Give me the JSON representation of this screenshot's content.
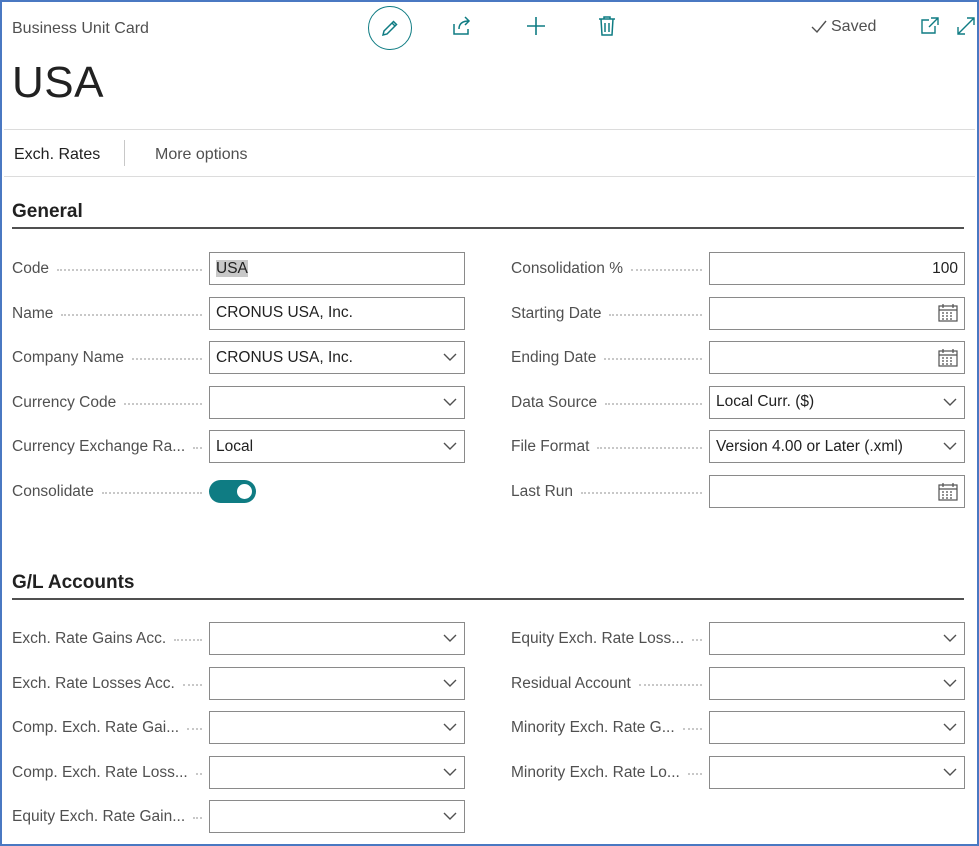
{
  "header": {
    "caption": "Business Unit Card",
    "title": "USA",
    "status": "Saved",
    "icons": [
      "edit-icon",
      "share-icon",
      "add-icon",
      "delete-icon",
      "checkmark-icon",
      "open-in-new-window-icon",
      "expand-icon"
    ]
  },
  "actions": {
    "exch_rates": "Exch. Rates",
    "more_options": "More options"
  },
  "general": {
    "title": "General",
    "left": [
      {
        "label": "Code",
        "value": "USA",
        "control": "text-selected"
      },
      {
        "label": "Name",
        "value": "CRONUS USA, Inc.",
        "control": "text"
      },
      {
        "label": "Company Name",
        "value": "CRONUS USA, Inc.",
        "control": "dropdown"
      },
      {
        "label": "Currency Code",
        "value": "",
        "control": "dropdown"
      },
      {
        "label": "Currency Exchange Ra...",
        "value": "Local",
        "control": "dropdown"
      },
      {
        "label": "Consolidate",
        "value": "on",
        "control": "toggle"
      }
    ],
    "right": [
      {
        "label": "Consolidation %",
        "value": "100",
        "control": "number"
      },
      {
        "label": "Starting Date",
        "value": "",
        "control": "date"
      },
      {
        "label": "Ending Date",
        "value": "",
        "control": "date"
      },
      {
        "label": "Data Source",
        "value": "Local Curr. ($)",
        "control": "dropdown"
      },
      {
        "label": "File Format",
        "value": "Version 4.00 or Later (.xml)",
        "control": "dropdown"
      },
      {
        "label": "Last Run",
        "value": "",
        "control": "date"
      }
    ]
  },
  "gl_accounts": {
    "title": "G/L Accounts",
    "left": [
      {
        "label": "Exch. Rate Gains Acc.",
        "value": "",
        "control": "dropdown"
      },
      {
        "label": "Exch. Rate Losses Acc.",
        "value": "",
        "control": "dropdown"
      },
      {
        "label": "Comp. Exch. Rate Gai...",
        "value": "",
        "control": "dropdown"
      },
      {
        "label": "Comp. Exch. Rate Loss...",
        "value": "",
        "control": "dropdown"
      },
      {
        "label": "Equity Exch. Rate Gain...",
        "value": "",
        "control": "dropdown"
      }
    ],
    "right": [
      {
        "label": "Equity Exch. Rate Loss...",
        "value": "",
        "control": "dropdown"
      },
      {
        "label": "Residual Account",
        "value": "",
        "control": "dropdown"
      },
      {
        "label": "Minority Exch. Rate G...",
        "value": "",
        "control": "dropdown"
      },
      {
        "label": "Minority Exch. Rate Lo...",
        "value": "",
        "control": "dropdown"
      }
    ]
  },
  "colors": {
    "accent": "#0f7c83",
    "frame_border": "#4a78c2",
    "label": "#505050",
    "input_border": "#8a8a8a"
  }
}
